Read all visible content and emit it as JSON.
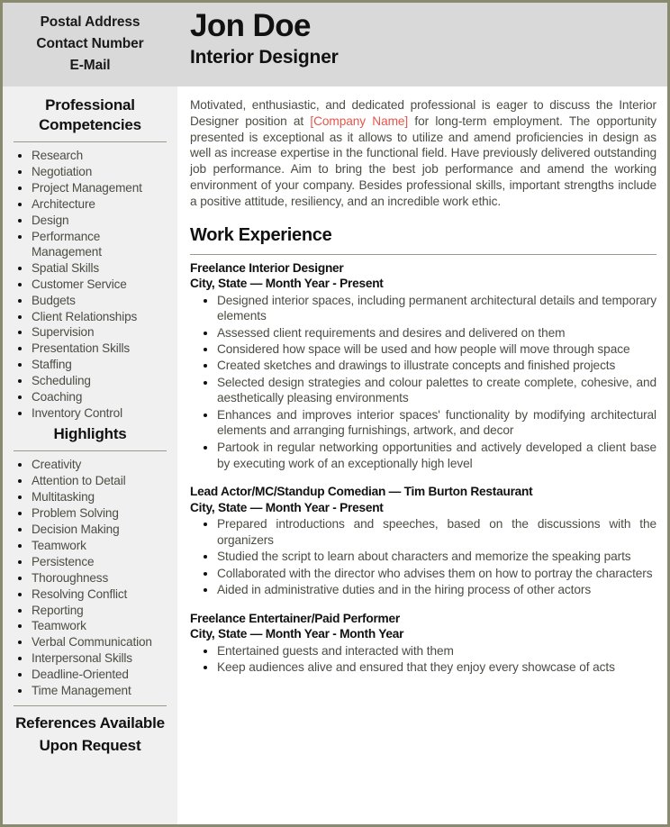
{
  "header": {
    "contact": [
      "Postal Address",
      "Contact Number",
      "E-Mail"
    ],
    "name": "Jon Doe",
    "title": "Interior Designer"
  },
  "sidebar": {
    "competencies_heading": "Professional Competencies",
    "competencies": [
      "Research",
      "Negotiation",
      "Project Management",
      "Architecture",
      "Design",
      "Performance Management",
      "Spatial Skills",
      "Customer Service",
      "Budgets",
      "Client Relationships",
      "Supervision",
      "Presentation Skills",
      "Staffing",
      "Scheduling",
      "Coaching",
      "Inventory Control"
    ],
    "highlights_heading": "Highlights",
    "highlights": [
      "Creativity",
      "Attention to Detail",
      "Multitasking",
      "Problem Solving",
      "Decision Making",
      "Teamwork",
      "Persistence",
      "Thoroughness",
      "Resolving Conflict",
      "Reporting",
      "Teamwork",
      "Verbal Communication",
      "Interpersonal Skills",
      "Deadline-Oriented",
      "Time Management"
    ],
    "references": "References Available Upon Request"
  },
  "main": {
    "summary_part1": "Motivated, enthusiastic, and dedicated professional is eager to discuss the Interior Designer position at ",
    "summary_company": "[Company Name]",
    "summary_part2": " for long-term employment. The opportunity presented is exceptional as it allows to utilize and amend proficiencies in design as well as increase expertise in the functional field. Have previously delivered outstanding job performance. Aim to bring the best job performance and amend the working environment of your company. Besides professional skills, important strengths include a positive attitude, resiliency, and an incredible work ethic.",
    "work_experience_heading": "Work Experience",
    "jobs": [
      {
        "title": "Freelance Interior Designer",
        "meta": "City, State — Month Year - Present",
        "bullets": [
          "Designed interior spaces, including permanent architectural details and temporary elements",
          "Assessed client requirements and desires and delivered on them",
          "Considered how space will be used and how people will move through space",
          "Created sketches and drawings to illustrate concepts and finished projects",
          "Selected design strategies and colour palettes to create complete, cohesive, and aesthetically pleasing environments",
          "Enhances and improves interior spaces' functionality by modifying architectural elements and arranging furnishings, artwork, and decor",
          "Partook in regular networking opportunities and actively developed a client base by executing work of an exceptionally high level"
        ]
      },
      {
        "title": "Lead Actor/MC/Standup Comedian — Tim Burton Restaurant",
        "meta": "City, State — Month Year - Present",
        "bullets": [
          "Prepared introductions and speeches, based on the discussions with the organizers",
          "Studied the script to learn about characters and memorize the speaking parts",
          "Collaborated with the director who advises them on how to portray the characters",
          "Aided in administrative duties and in the hiring process of other actors"
        ]
      },
      {
        "title": "Freelance Entertainer/Paid Performer",
        "meta": "City, State — Month Year - Month Year",
        "bullets": [
          "Entertained guests and interacted with them",
          "Keep audiences alive and ensured that they enjoy every showcase of acts"
        ]
      }
    ]
  }
}
